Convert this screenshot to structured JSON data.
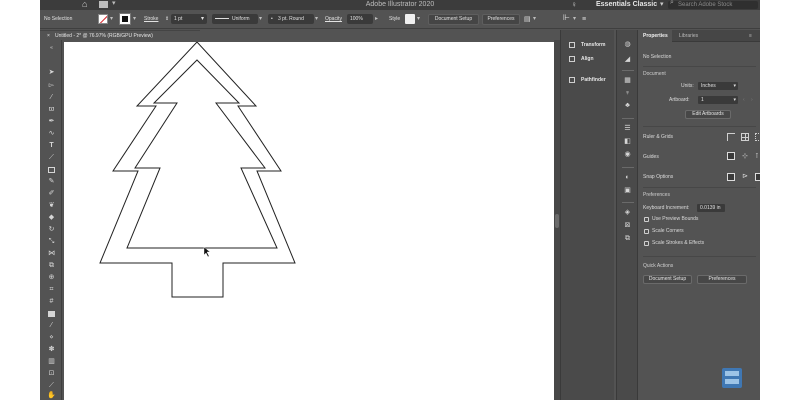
{
  "app": {
    "title": "Adobe Illustrator 2020",
    "workspace": "Essentials Classic",
    "search_placeholder": "Search Adobe Stock"
  },
  "control_bar": {
    "selection_status": "No Selection",
    "stroke_label": "Stroke",
    "stroke_weight": "1 pt",
    "stroke_profile": "Uniform",
    "brush": "3 pt. Round",
    "opacity_label": "Opacity",
    "opacity_value": "100%",
    "style_label": "Style",
    "document_setup_button": "Document Setup",
    "preferences_button": "Preferences"
  },
  "document_tab": {
    "close_glyph": "×",
    "name": "Untitled - 2* @ 76.97% (RGB/GPU Preview)"
  },
  "collapsed_panels": {
    "transform": "Transform",
    "align": "Align",
    "pathfinder": "Pathfinder"
  },
  "properties": {
    "tab_properties": "Properties",
    "tab_libraries": "Libraries",
    "selection": "No Selection",
    "document_heading": "Document",
    "units_label": "Units:",
    "units_value": "Inches",
    "artboard_label": "Artboard:",
    "artboard_value": "1",
    "edit_artboards_button": "Edit Artboards",
    "rulers_label": "Ruler & Grids",
    "guides_label": "Guides",
    "snap_label": "Snap Options",
    "preferences_heading": "Preferences",
    "keyboard_increment_label": "Keyboard Increment:",
    "keyboard_increment_value": "0.0139 in",
    "use_preview_bounds": "Use Preview Bounds",
    "scale_corners": "Scale Corners",
    "scale_strokes": "Scale Strokes & Effects",
    "quick_actions_heading": "Quick Actions",
    "document_setup_button": "Document Setup",
    "preferences_button": "Preferences"
  },
  "colors": {
    "ui_background": "#535353",
    "panel_dark": "#4a4a4a",
    "titlebar": "#3c3c3c",
    "artboard": "#ffffff",
    "shape_stroke": "#222222",
    "no_fill_slash": "#d8262d"
  },
  "icons": [
    "home-icon",
    "workspace-grid-icon",
    "lightbulb-icon",
    "search-icon",
    "selection-tool-icon",
    "direct-selection-tool-icon",
    "magic-wand-icon",
    "lasso-icon",
    "pen-tool-icon",
    "curvature-tool-icon",
    "type-tool-icon",
    "line-tool-icon",
    "rectangle-tool-icon",
    "paintbrush-icon",
    "pencil-icon",
    "shaper-icon",
    "eraser-icon",
    "rotate-tool-icon",
    "scale-tool-icon",
    "width-tool-icon",
    "free-transform-icon",
    "shape-builder-icon",
    "perspective-icon",
    "mesh-icon",
    "gradient-icon",
    "eyedropper-icon",
    "blend-icon",
    "symbol-sprayer-icon",
    "graph-icon",
    "artboard-tool-icon",
    "slice-icon",
    "hand-tool-icon",
    "zoom-tool-icon",
    "mouse-cursor-icon"
  ]
}
